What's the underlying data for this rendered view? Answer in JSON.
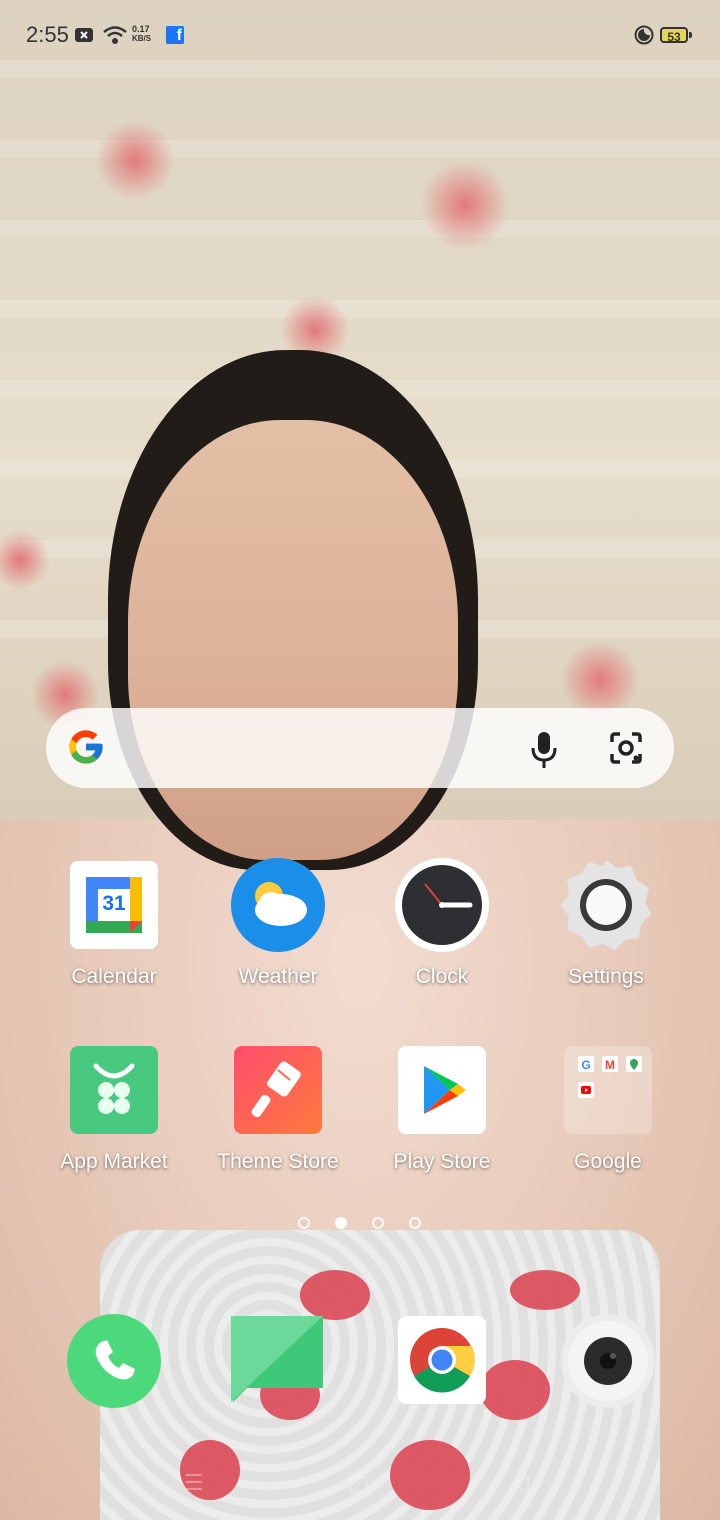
{
  "status_bar": {
    "time": "2:55",
    "network_speed_value": "0.17",
    "network_speed_unit": "KB/S",
    "battery_level": "53",
    "icons": [
      "notification-x-icon",
      "wifi-icon",
      "facebook-icon",
      "dnd-icon",
      "battery-icon"
    ]
  },
  "search_bar": {
    "icons": [
      "google-g-icon",
      "microphone-icon",
      "google-lens-icon"
    ]
  },
  "home_apps": [
    {
      "label": "Calendar",
      "badge": "31",
      "icon": "calendar-icon"
    },
    {
      "label": "Weather",
      "icon": "weather-icon"
    },
    {
      "label": "Clock",
      "icon": "clock-icon"
    },
    {
      "label": "Settings",
      "icon": "settings-icon"
    },
    {
      "label": "App Market",
      "icon": "app-market-icon"
    },
    {
      "label": "Theme Store",
      "icon": "theme-store-icon"
    },
    {
      "label": "Play Store",
      "icon": "play-store-icon"
    },
    {
      "label": "Google",
      "icon": "google-folder-icon"
    }
  ],
  "page_indicator": {
    "pages": 4,
    "current": 2
  },
  "dock": [
    {
      "name": "Phone",
      "icon": "phone-icon"
    },
    {
      "name": "Messages",
      "icon": "messages-icon"
    },
    {
      "name": "Chrome",
      "icon": "chrome-icon"
    },
    {
      "name": "Camera",
      "icon": "camera-icon"
    }
  ],
  "colors": {
    "calendar_blue": "#4285f4",
    "weather_blue": "#1a8ee8",
    "app_market_green": "#49c87f",
    "theme_store_red": "#f25a4a",
    "phone_green": "#4cd97b",
    "messages_green": "#3ec97a",
    "battery_fill": "#e7d55a",
    "facebook_blue": "#1877f2"
  }
}
